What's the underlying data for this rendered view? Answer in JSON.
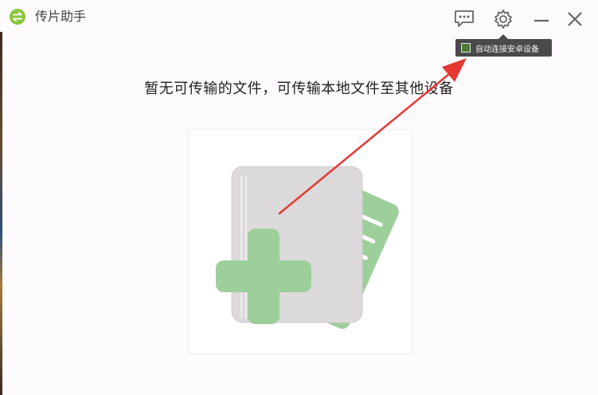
{
  "window": {
    "title": "传片助手",
    "logo_icon": "app-logo-icon"
  },
  "toolbar": {
    "feedback_icon": "chat-bubble-icon",
    "settings_icon": "gear-icon",
    "minimize_icon": "minimize-icon",
    "close_icon": "close-icon"
  },
  "tooltip": {
    "checkbox_checked": true,
    "label": "自动连接安卓设备"
  },
  "main": {
    "empty_message": "暂无可传输的文件，可传输本地文件至其他设备",
    "drop_icon": "add-file-icon"
  },
  "colors": {
    "accent_green": "#8cc63f",
    "plus_green": "#9dcf9b",
    "doc_gray": "#dcdadb",
    "arrow_red": "#e53935"
  }
}
